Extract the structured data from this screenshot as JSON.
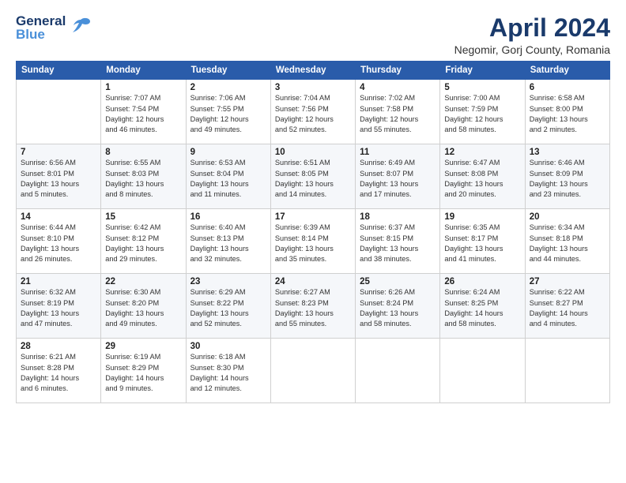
{
  "header": {
    "logo_line1": "General",
    "logo_line2": "Blue",
    "title": "April 2024",
    "subtitle": "Negomir, Gorj County, Romania"
  },
  "columns": [
    "Sunday",
    "Monday",
    "Tuesday",
    "Wednesday",
    "Thursday",
    "Friday",
    "Saturday"
  ],
  "rows": [
    [
      {
        "day": "",
        "detail": ""
      },
      {
        "day": "1",
        "detail": "Sunrise: 7:07 AM\nSunset: 7:54 PM\nDaylight: 12 hours\nand 46 minutes."
      },
      {
        "day": "2",
        "detail": "Sunrise: 7:06 AM\nSunset: 7:55 PM\nDaylight: 12 hours\nand 49 minutes."
      },
      {
        "day": "3",
        "detail": "Sunrise: 7:04 AM\nSunset: 7:56 PM\nDaylight: 12 hours\nand 52 minutes."
      },
      {
        "day": "4",
        "detail": "Sunrise: 7:02 AM\nSunset: 7:58 PM\nDaylight: 12 hours\nand 55 minutes."
      },
      {
        "day": "5",
        "detail": "Sunrise: 7:00 AM\nSunset: 7:59 PM\nDaylight: 12 hours\nand 58 minutes."
      },
      {
        "day": "6",
        "detail": "Sunrise: 6:58 AM\nSunset: 8:00 PM\nDaylight: 13 hours\nand 2 minutes."
      }
    ],
    [
      {
        "day": "7",
        "detail": "Sunrise: 6:56 AM\nSunset: 8:01 PM\nDaylight: 13 hours\nand 5 minutes."
      },
      {
        "day": "8",
        "detail": "Sunrise: 6:55 AM\nSunset: 8:03 PM\nDaylight: 13 hours\nand 8 minutes."
      },
      {
        "day": "9",
        "detail": "Sunrise: 6:53 AM\nSunset: 8:04 PM\nDaylight: 13 hours\nand 11 minutes."
      },
      {
        "day": "10",
        "detail": "Sunrise: 6:51 AM\nSunset: 8:05 PM\nDaylight: 13 hours\nand 14 minutes."
      },
      {
        "day": "11",
        "detail": "Sunrise: 6:49 AM\nSunset: 8:07 PM\nDaylight: 13 hours\nand 17 minutes."
      },
      {
        "day": "12",
        "detail": "Sunrise: 6:47 AM\nSunset: 8:08 PM\nDaylight: 13 hours\nand 20 minutes."
      },
      {
        "day": "13",
        "detail": "Sunrise: 6:46 AM\nSunset: 8:09 PM\nDaylight: 13 hours\nand 23 minutes."
      }
    ],
    [
      {
        "day": "14",
        "detail": "Sunrise: 6:44 AM\nSunset: 8:10 PM\nDaylight: 13 hours\nand 26 minutes."
      },
      {
        "day": "15",
        "detail": "Sunrise: 6:42 AM\nSunset: 8:12 PM\nDaylight: 13 hours\nand 29 minutes."
      },
      {
        "day": "16",
        "detail": "Sunrise: 6:40 AM\nSunset: 8:13 PM\nDaylight: 13 hours\nand 32 minutes."
      },
      {
        "day": "17",
        "detail": "Sunrise: 6:39 AM\nSunset: 8:14 PM\nDaylight: 13 hours\nand 35 minutes."
      },
      {
        "day": "18",
        "detail": "Sunrise: 6:37 AM\nSunset: 8:15 PM\nDaylight: 13 hours\nand 38 minutes."
      },
      {
        "day": "19",
        "detail": "Sunrise: 6:35 AM\nSunset: 8:17 PM\nDaylight: 13 hours\nand 41 minutes."
      },
      {
        "day": "20",
        "detail": "Sunrise: 6:34 AM\nSunset: 8:18 PM\nDaylight: 13 hours\nand 44 minutes."
      }
    ],
    [
      {
        "day": "21",
        "detail": "Sunrise: 6:32 AM\nSunset: 8:19 PM\nDaylight: 13 hours\nand 47 minutes."
      },
      {
        "day": "22",
        "detail": "Sunrise: 6:30 AM\nSunset: 8:20 PM\nDaylight: 13 hours\nand 49 minutes."
      },
      {
        "day": "23",
        "detail": "Sunrise: 6:29 AM\nSunset: 8:22 PM\nDaylight: 13 hours\nand 52 minutes."
      },
      {
        "day": "24",
        "detail": "Sunrise: 6:27 AM\nSunset: 8:23 PM\nDaylight: 13 hours\nand 55 minutes."
      },
      {
        "day": "25",
        "detail": "Sunrise: 6:26 AM\nSunset: 8:24 PM\nDaylight: 13 hours\nand 58 minutes."
      },
      {
        "day": "26",
        "detail": "Sunrise: 6:24 AM\nSunset: 8:25 PM\nDaylight: 14 hours\nand 58 minutes."
      },
      {
        "day": "27",
        "detail": "Sunrise: 6:22 AM\nSunset: 8:27 PM\nDaylight: 14 hours\nand 4 minutes."
      }
    ],
    [
      {
        "day": "28",
        "detail": "Sunrise: 6:21 AM\nSunset: 8:28 PM\nDaylight: 14 hours\nand 6 minutes."
      },
      {
        "day": "29",
        "detail": "Sunrise: 6:19 AM\nSunset: 8:29 PM\nDaylight: 14 hours\nand 9 minutes."
      },
      {
        "day": "30",
        "detail": "Sunrise: 6:18 AM\nSunset: 8:30 PM\nDaylight: 14 hours\nand 12 minutes."
      },
      {
        "day": "",
        "detail": ""
      },
      {
        "day": "",
        "detail": ""
      },
      {
        "day": "",
        "detail": ""
      },
      {
        "day": "",
        "detail": ""
      }
    ]
  ]
}
